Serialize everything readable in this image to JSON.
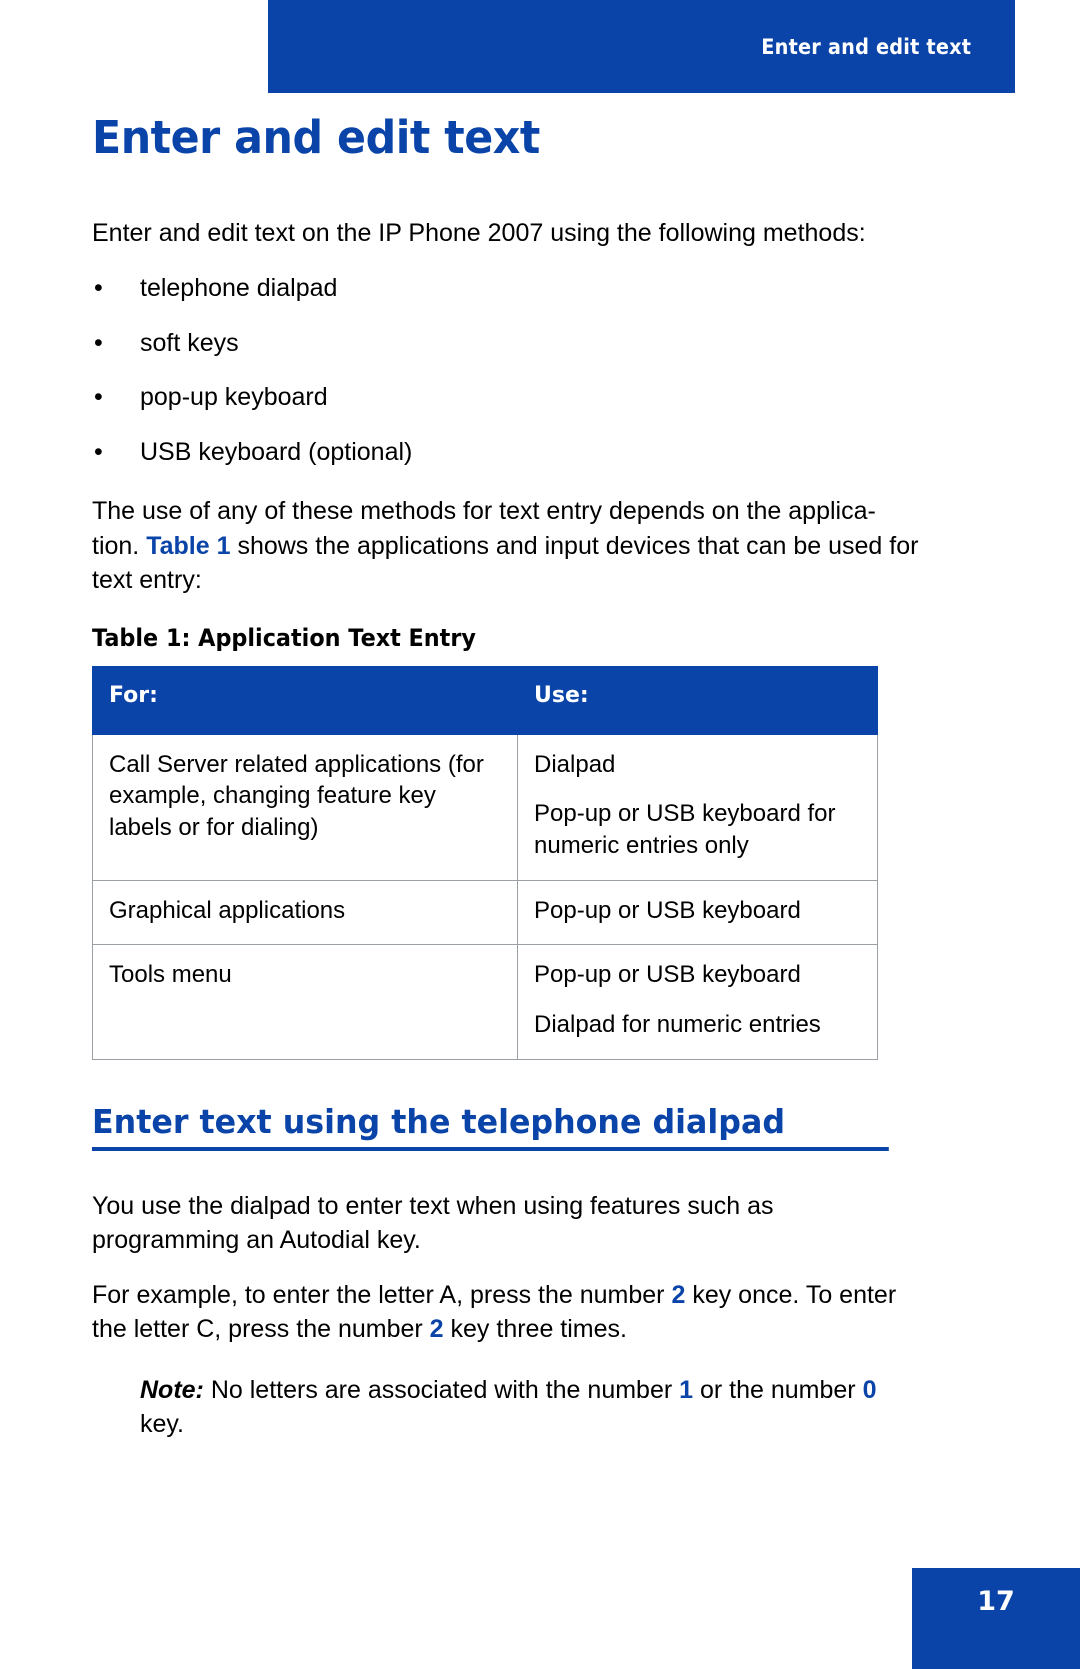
{
  "header": {
    "running_head": "Enter and edit text"
  },
  "chapter": {
    "title": "Enter and edit text"
  },
  "intro": {
    "lead_paragraph": "Enter and edit text on the IP Phone 2007 using the following methods:",
    "bullets": [
      "telephone dialpad",
      "soft keys",
      "pop-up keyboard",
      "USB keyboard (optional)"
    ],
    "bullet_marker": "•",
    "methods_paragraph_part1": "The use of any of these methods for text entry depends on the applica-tion.",
    "methods_paragraph_prefix": "The use of any of these methods for text entry depends on the applica-",
    "methods_paragraph_line2_prefix": "tion. ",
    "xref_label": "Table 1",
    "methods_paragraph_suffix": " shows the applications and input devices that can be used for text entry:"
  },
  "table": {
    "caption": "Table 1: Application Text Entry",
    "columns": [
      "For:",
      "Use:"
    ],
    "rows": [
      {
        "for_lines": [
          "Call Server related applications (for example, changing feature key labels or for dialing)"
        ],
        "use_lines": [
          "Dialpad",
          "Pop-up or USB keyboard for numeric entries only"
        ]
      },
      {
        "for_lines": [
          "Graphical applications"
        ],
        "use_lines": [
          "Pop-up or USB keyboard"
        ]
      },
      {
        "for_lines": [
          "Tools menu"
        ],
        "use_lines": [
          "Pop-up or USB keyboard",
          "Dialpad for numeric entries"
        ]
      }
    ]
  },
  "section": {
    "heading": "Enter text using the telephone dialpad",
    "paragraph1": "You use the dialpad to enter text when using features such as programming an Autodial key.",
    "example_part1": "For example, to enter the letter A, press the number ",
    "example_key1": "2",
    "example_part2": " key once. To enter the letter C, press the number ",
    "example_key2": "2",
    "example_part3": " key three times.",
    "note_label": "Note:",
    "note_part1": " No letters are associated with the number ",
    "note_key1": "1",
    "note_part2": " or the number ",
    "note_key2": "0",
    "note_part3": " key."
  },
  "footer": {
    "page_number": "17"
  },
  "colors": {
    "brand_blue": "#0A44A8",
    "text_black": "#000000",
    "table_border": "#9aa0a6"
  }
}
